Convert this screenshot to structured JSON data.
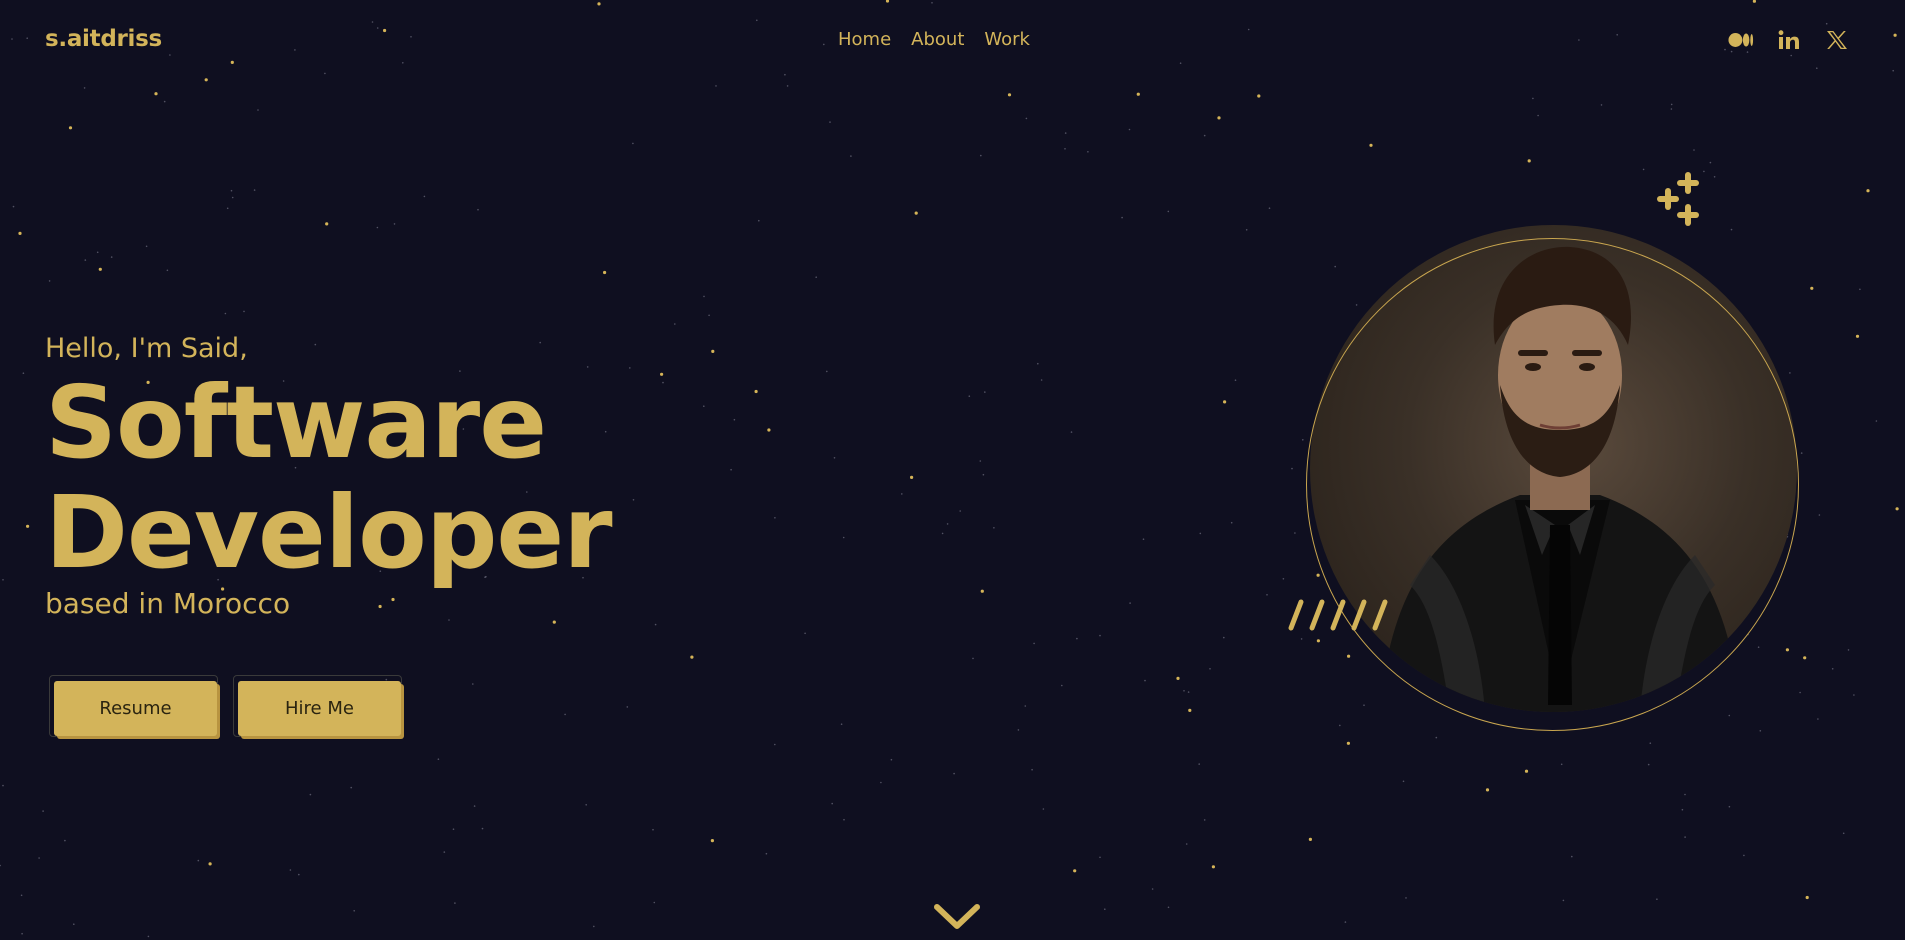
{
  "brand": {
    "name": "s.aitdriss"
  },
  "nav": {
    "items": [
      "Home",
      "About",
      "Work"
    ]
  },
  "socials": [
    {
      "name": "Medium",
      "icon": "medium-icon"
    },
    {
      "name": "LinkedIn",
      "icon": "linkedin-icon"
    },
    {
      "name": "X",
      "icon": "x-icon"
    }
  ],
  "hero": {
    "greeting": "Hello, I'm Said,",
    "title_line1": "Software",
    "title_line2": "Developer",
    "location": "based in Morocco"
  },
  "buttons": {
    "resume": "Resume",
    "hire": "Hire Me"
  },
  "portrait": {
    "icon": "profile-photo"
  },
  "colors": {
    "background": "#0f0f20",
    "accent": "#d3b45a"
  }
}
